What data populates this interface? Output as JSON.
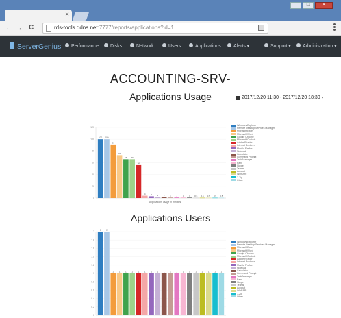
{
  "browser": {
    "tab_close": "×",
    "back": "←",
    "forward": "→",
    "reload": "C",
    "url_host": "rds-tools.ddns.net",
    "url_path": ":7777/reports/applications?id=1",
    "window_buttons": [
      "—",
      "□",
      "✕"
    ]
  },
  "navbar": {
    "brand": "ServerGenius",
    "items": [
      {
        "label": "Performance",
        "icon": "dashboard-icon"
      },
      {
        "label": "Disks",
        "icon": "disk-icon"
      },
      {
        "label": "Network",
        "icon": "globe-icon"
      },
      {
        "label": "Users",
        "icon": "user-icon"
      },
      {
        "label": "Applications",
        "icon": "grid-icon"
      },
      {
        "label": "Alerts",
        "icon": "alert-icon",
        "caret": "▾"
      },
      {
        "label": "Support",
        "icon": "question-icon",
        "caret": "▾"
      },
      {
        "label": "Administration",
        "icon": "wrench-icon",
        "caret": "▾"
      }
    ]
  },
  "page": {
    "title": "ACCOUNTING-SRV-",
    "date_range": "2017/12/20 11:30 - 2017/12/20 18:30",
    "date_caret": "▾"
  },
  "colors": {
    "navbar_bg": "#2d3338",
    "brand": "#7fb7e6",
    "chrome": "#5a83b8"
  },
  "charts": {
    "usage_title": "Applications Usage",
    "users_title": "Applications Users"
  },
  "chart_data": [
    {
      "type": "bar",
      "title": "Applications Usage",
      "xlabel": "Applications usage in minutes",
      "ylim": [
        0,
        120
      ],
      "yticks": [
        "0",
        "20",
        "40",
        "60",
        "80",
        "100",
        "120"
      ],
      "series": [
        {
          "name": "Windows Explorer",
          "color": "#2f7ec1",
          "value": 100
        },
        {
          "name": "Remote Desktop Services Manager",
          "color": "#a7c7e7",
          "value": 100
        },
        {
          "name": "Microsoft Excel",
          "color": "#f39c3b",
          "value": 91
        },
        {
          "name": "Microsoft Word",
          "color": "#f9c987",
          "value": 73
        },
        {
          "name": "Google Chrome",
          "color": "#3fa34d",
          "value": 66
        },
        {
          "name": "Microsoft Outlook",
          "color": "#9ed28a",
          "value": 66
        },
        {
          "name": "Adobe Reader",
          "color": "#d62728",
          "value": 56
        },
        {
          "name": "Internet Explorer",
          "color": "#f4a7a7",
          "value": 4
        },
        {
          "name": "Mozilla Firefox",
          "color": "#9467bd",
          "value": 3
        },
        {
          "name": "Notepad",
          "color": "#c5b0d5",
          "value": 2
        },
        {
          "name": "Calculator",
          "color": "#8c564b",
          "value": 2
        },
        {
          "name": "Command Prompt",
          "color": "#c49c94",
          "value": 1
        },
        {
          "name": "Task Manager",
          "color": "#e377c2",
          "value": 1
        },
        {
          "name": "Paint",
          "color": "#f7b6d2",
          "value": 1
        },
        {
          "name": "Skype",
          "color": "#7f7f7f",
          "value": 1
        },
        {
          "name": "Teams",
          "color": "#c7c7c7",
          "value": 0.5
        },
        {
          "name": "Acrobat",
          "color": "#bcbd22",
          "value": 0.5
        },
        {
          "name": "WinRAR",
          "color": "#dbdb8d",
          "value": 0.5
        },
        {
          "name": "7-Zip",
          "color": "#17becf",
          "value": 0.5
        },
        {
          "name": "Other",
          "color": "#9edae5",
          "value": 0.5
        }
      ]
    },
    {
      "type": "bar",
      "title": "Applications Users",
      "ylim": [
        0,
        2
      ],
      "yticks": [
        "0",
        "0.2",
        "0.4",
        "0.6",
        "0.8",
        "1",
        "1.2",
        "1.4",
        "1.6",
        "1.8",
        "2"
      ],
      "series": [
        {
          "name": "Windows Explorer",
          "color": "#2f7ec1",
          "value": 2
        },
        {
          "name": "Remote Desktop Services Manager",
          "color": "#a7c7e7",
          "value": 2
        },
        {
          "name": "Microsoft Excel",
          "color": "#f39c3b",
          "value": 1
        },
        {
          "name": "Microsoft Word",
          "color": "#f9c987",
          "value": 1
        },
        {
          "name": "Google Chrome",
          "color": "#3fa34d",
          "value": 1
        },
        {
          "name": "Microsoft Outlook",
          "color": "#9ed28a",
          "value": 1
        },
        {
          "name": "Adobe Reader",
          "color": "#d62728",
          "value": 1
        },
        {
          "name": "Internet Explorer",
          "color": "#f4a7a7",
          "value": 1
        },
        {
          "name": "Mozilla Firefox",
          "color": "#9467bd",
          "value": 1
        },
        {
          "name": "Notepad",
          "color": "#c5b0d5",
          "value": 1
        },
        {
          "name": "Calculator",
          "color": "#8c564b",
          "value": 1
        },
        {
          "name": "Command Prompt",
          "color": "#c49c94",
          "value": 1
        },
        {
          "name": "Task Manager",
          "color": "#e377c2",
          "value": 1
        },
        {
          "name": "Paint",
          "color": "#f7b6d2",
          "value": 1
        },
        {
          "name": "Skype",
          "color": "#7f7f7f",
          "value": 1
        },
        {
          "name": "Teams",
          "color": "#c7c7c7",
          "value": 1
        },
        {
          "name": "Acrobat",
          "color": "#bcbd22",
          "value": 1
        },
        {
          "name": "WinRAR",
          "color": "#dbdb8d",
          "value": 1
        },
        {
          "name": "7-Zip",
          "color": "#17becf",
          "value": 1
        },
        {
          "name": "Other",
          "color": "#9edae5",
          "value": 1
        }
      ]
    }
  ]
}
